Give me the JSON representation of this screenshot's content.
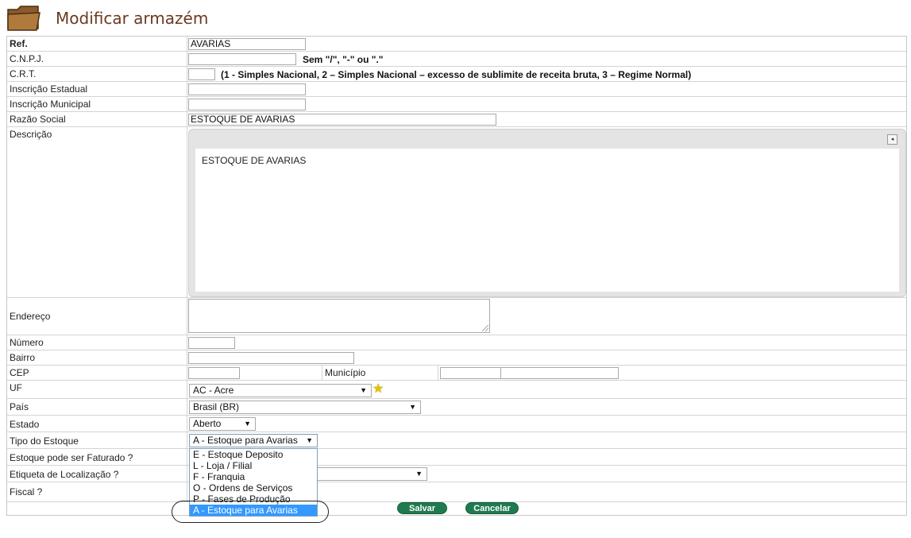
{
  "header": {
    "title": "Modificar armazém"
  },
  "form": {
    "ref": {
      "label": "Ref.",
      "value": "AVARIAS"
    },
    "cnpj": {
      "label": "C.N.P.J.",
      "value": "",
      "hint": "Sem \"/\", \"-\" ou \".\""
    },
    "crt": {
      "label": "C.R.T.",
      "value": "",
      "hint": "(1 - Simples Nacional, 2 – Simples Nacional – excesso de sublimite de receita bruta, 3 – Regime Normal)"
    },
    "inscricao_estadual": {
      "label": "Inscrição Estadual",
      "value": ""
    },
    "inscricao_municipal": {
      "label": "Inscrição Municipal",
      "value": ""
    },
    "razao_social": {
      "label": "Razão Social",
      "value": "ESTOQUE DE AVARIAS"
    },
    "descricao": {
      "label": "Descrição",
      "value": "ESTOQUE DE AVARIAS"
    },
    "endereco": {
      "label": "Endereço",
      "value": ""
    },
    "numero": {
      "label": "Número",
      "value": ""
    },
    "bairro": {
      "label": "Bairro",
      "value": ""
    },
    "cep": {
      "label": "CEP",
      "value": ""
    },
    "municipio": {
      "label": "Município",
      "code": "",
      "value": ""
    },
    "uf": {
      "label": "UF",
      "selected": "AC - Acre"
    },
    "pais": {
      "label": "País",
      "selected": "Brasil (BR)"
    },
    "estado": {
      "label": "Estado",
      "selected": "Aberto"
    },
    "tipo_estoque": {
      "label": "Tipo do Estoque",
      "selected": "A - Estoque para Avarias",
      "options": [
        "E - Estoque Deposito",
        "L - Loja / Filial",
        "F - Franquia",
        "O - Ordens de Serviços",
        "P - Fases de Produção",
        "A - Estoque para Avarias"
      ]
    },
    "faturado": {
      "label": "Estoque pode ser Faturado ?"
    },
    "etiqueta": {
      "label": "Etiqueta de Localização ?",
      "selected": ""
    },
    "fiscal": {
      "label": "Fiscal ?"
    }
  },
  "buttons": {
    "save": "Salvar",
    "cancel": "Cancelar"
  },
  "colors": {
    "title": "#6b3a1f",
    "button": "#1f7a4f",
    "highlight": "#3399ff"
  }
}
